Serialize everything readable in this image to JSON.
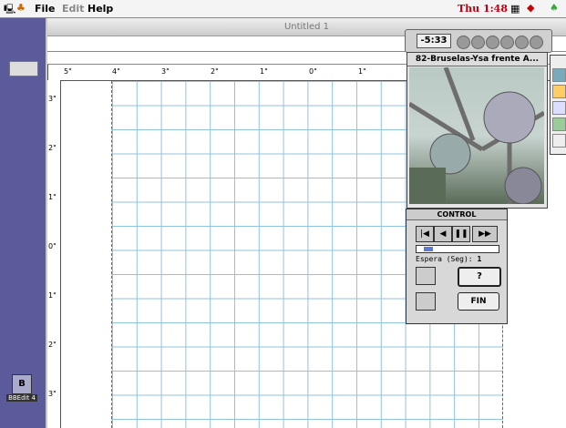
{
  "menubar": {
    "menus": [
      "File",
      "Edit",
      "Help"
    ],
    "clock": "Thu 1:48"
  },
  "document": {
    "title": "Untitled 1"
  },
  "ruler": {
    "h_labels": [
      "5\"",
      "4\"",
      "3\"",
      "2\"",
      "1\"",
      "0\"",
      "1\""
    ],
    "v_labels": [
      "3\"",
      "2\"",
      "1\"",
      "0\"",
      "1\"",
      "2\"",
      "3\""
    ]
  },
  "video": {
    "time": "-5:33"
  },
  "photo": {
    "title": "82-Bruselas-Ysa frente A..."
  },
  "control": {
    "title": "CONTROL",
    "espera_label": "Espera (Seg):",
    "espera_value": "1",
    "help_label": "?",
    "fin_label": "FIN"
  },
  "desktop": {
    "icon_label": "BBEdit 4"
  },
  "colors": {
    "clock": "#c00010",
    "grid": "#8fc3de",
    "left_strip": "#5b5b9b",
    "slider_fill": "#5a7ad6"
  }
}
